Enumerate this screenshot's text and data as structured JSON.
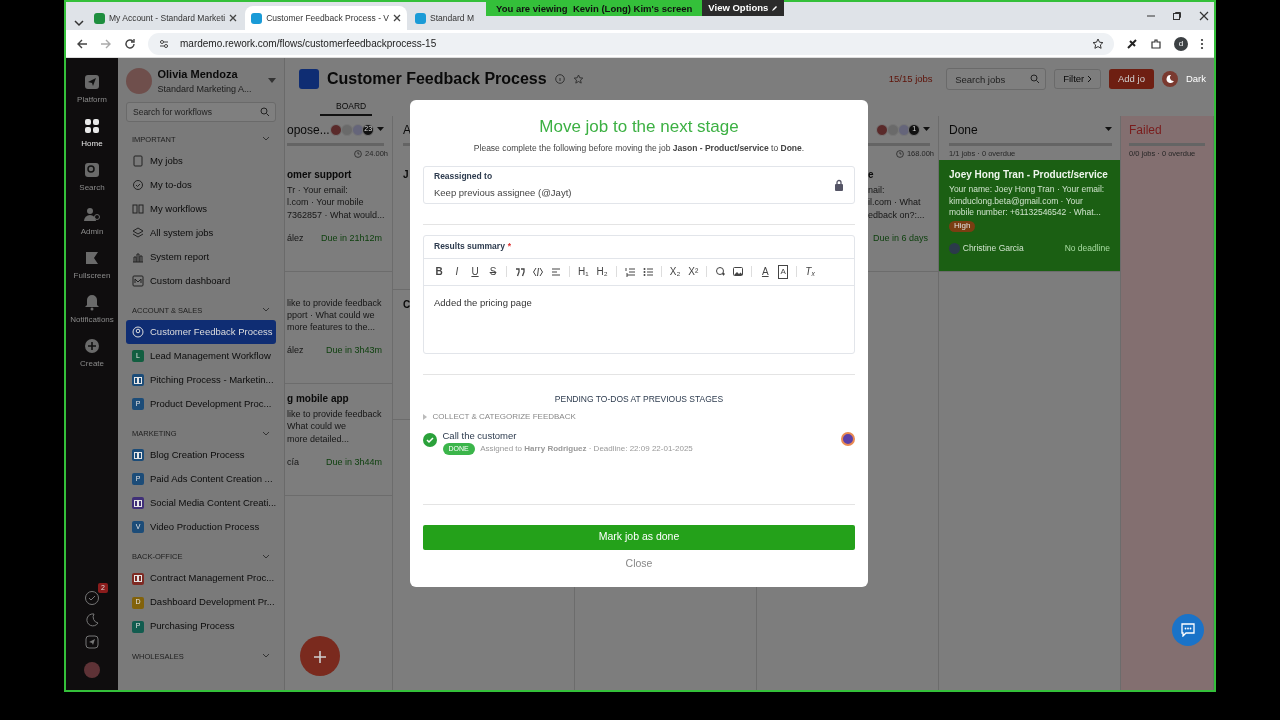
{
  "share_banner": {
    "text": "You are viewing  Kevin (Long) Kim's screen",
    "button": "View Options"
  },
  "browser": {
    "tabs": [
      {
        "title": "My Account - Standard Marketi",
        "selected": false,
        "color": "#1e8e3e"
      },
      {
        "title": "Customer Feedback Process - V",
        "selected": true,
        "color": "#1a9bd7"
      },
      {
        "title": "Standard M",
        "selected": false,
        "color": "#1a9bd7"
      }
    ],
    "url": "mardemo.rework.com/flows/customerfeedbackprocess-15",
    "profile": "d"
  },
  "rail": {
    "items": [
      {
        "label": "Platform",
        "selected": false
      },
      {
        "label": "Home",
        "selected": true
      },
      {
        "label": "Search",
        "selected": false
      },
      {
        "label": "Admin",
        "selected": false
      },
      {
        "label": "Fullscreen",
        "selected": false
      },
      {
        "label": "Notifications",
        "selected": false
      },
      {
        "label": "Create",
        "selected": false
      }
    ],
    "todo_badge": "2"
  },
  "user": {
    "name": "Olivia Mendoza",
    "org": "Standard Marketing A..."
  },
  "sidebar": {
    "search": {
      "placeholder": "Search for workflows"
    },
    "sections": [
      {
        "title": "IMPORTANT",
        "items": [
          {
            "kind": "nav",
            "label": "My jobs",
            "selected": false
          },
          {
            "kind": "nav",
            "label": "My to-dos",
            "selected": false
          },
          {
            "kind": "nav",
            "label": "My workflows",
            "selected": false
          },
          {
            "kind": "nav",
            "label": "All system jobs",
            "selected": false
          },
          {
            "kind": "nav",
            "label": "System report",
            "selected": false
          },
          {
            "kind": "nav",
            "label": "Custom dashboard",
            "selected": false
          }
        ]
      },
      {
        "title": "ACCOUNT & SALES",
        "items": [
          {
            "kind": "nav",
            "label": "Customer Feedback Process",
            "selected": true
          },
          {
            "kind": "workflow",
            "letter": "L",
            "label": "Lead Management Workflow",
            "color": "#125e40",
            "selected": false
          },
          {
            "kind": "workflow",
            "label": "Pitching Process - Marketin...",
            "color": "#1c4c78",
            "selected": false
          },
          {
            "kind": "workflow",
            "letter": "P",
            "label": "Product Development Proc...",
            "color": "#1c4c78",
            "selected": false
          }
        ]
      },
      {
        "title": "MARKETING",
        "items": [
          {
            "kind": "workflow",
            "label": "Blog Creation Process",
            "color": "#1c4c78",
            "selected": false
          },
          {
            "kind": "workflow",
            "letter": "P",
            "label": "Paid Ads Content Creation ...",
            "color": "#1c4c78",
            "selected": false
          },
          {
            "kind": "workflow",
            "label": "Social Media Content Creati...",
            "color": "#3f2f78",
            "selected": false
          },
          {
            "kind": "workflow",
            "letter": "V",
            "label": "Video Production Process",
            "color": "#1c4c78",
            "selected": false
          }
        ]
      },
      {
        "title": "BACK-OFFICE",
        "items": [
          {
            "kind": "workflow",
            "label": "Contract Management Proc...",
            "color": "#7e2a23",
            "selected": false
          },
          {
            "kind": "workflow",
            "letter": "D",
            "label": "Dashboard Development Pr...",
            "color": "#82620b",
            "selected": false
          },
          {
            "kind": "workflow",
            "letter": "P",
            "label": "Purchasing Process",
            "color": "#125c4f",
            "selected": false
          }
        ]
      },
      {
        "title": "WHOLESALES"
      }
    ]
  },
  "header": {
    "title": "Customer Feedback Process",
    "job_count": "15/15 jobs",
    "search": {
      "placeholder": "Search jobs"
    },
    "filter": "Filter",
    "add": "Add jo",
    "theme": "Dark",
    "tab": "BOARD"
  },
  "columns": [
    {
      "title": "opose...",
      "count": "23",
      "duration": "24.00h",
      "cards": [
        {
          "title": "omer support",
          "lines": [
            "Tr · Your email:",
            "l.com · Your mobile",
            "7362857 · What would..."
          ],
          "assignee": "ález",
          "due": "Due in 21h12m"
        },
        {
          "lines": [
            "like to provide feedback",
            "pport · What could we",
            "more features to the..."
          ],
          "assignee": "ález",
          "due": "Due in 3h43m"
        },
        {
          "title": "g mobile app",
          "lines": [
            "like to provide feedback",
            "What could we",
            "more detailed..."
          ],
          "assignee": "cía",
          "due": "Due in 3h44m"
        }
      ]
    },
    {
      "title": "A",
      "cards": [
        {
          "title": "J"
        },
        {
          "title": "C"
        }
      ]
    },
    {},
    {
      "count": "1",
      "duration": "168.00h",
      "cards": [
        {
          "title": "e",
          "lines": [
            "nail:",
            "il.com · What",
            "edback on?:..."
          ],
          "due": "Due in 6 days"
        }
      ]
    },
    {
      "title": "Done",
      "stats": "1/1 jobs · 0 overdue",
      "cards": [
        {
          "title": "Joey Hong Tran - Product/service",
          "lines": [
            "Your name: Joey Hong Tran · Your email: kimduclong.beta@gmail.com · Your mobile number: +61132546542 · What..."
          ],
          "tag": "High",
          "assignee": "Christine Garcia",
          "due": "No deadline",
          "color": "#1b5f13"
        }
      ]
    },
    {
      "title": "Failed",
      "stats": "0/0 jobs · 0 overdue",
      "color": "#7a1c1c"
    }
  ],
  "modal": {
    "title": "Move job to the next stage",
    "subtitle": "Please complete the following before moving the job **Jason - Product/service** to **Done**.",
    "reassigned": {
      "label": "Reassigned to",
      "value": "Keep previous assignee (@Jayt)"
    },
    "summary": {
      "label": "Results summary",
      "required_mark": "*",
      "text": "Added the pricing page",
      "toolbar": [
        {
          "kind": "text",
          "glyph": "B"
        },
        {
          "kind": "text",
          "glyph": "I"
        },
        {
          "kind": "text",
          "glyph": "U"
        },
        {
          "kind": "text",
          "glyph": "S"
        },
        {
          "kind": "sep"
        },
        {
          "kind": "quote"
        },
        {
          "kind": "code"
        },
        {
          "kind": "align"
        },
        {
          "kind": "sep"
        },
        {
          "kind": "text",
          "glyph": "H₁"
        },
        {
          "kind": "text",
          "glyph": "H₂"
        },
        {
          "kind": "sep"
        },
        {
          "kind": "ol"
        },
        {
          "kind": "ul"
        },
        {
          "kind": "sep"
        },
        {
          "kind": "text",
          "glyph": "X₂"
        },
        {
          "kind": "text",
          "glyph": "X²"
        },
        {
          "kind": "sep"
        },
        {
          "kind": "link"
        },
        {
          "kind": "image"
        },
        {
          "kind": "sep"
        },
        {
          "kind": "text",
          "glyph": "A"
        },
        {
          "kind": "boxed",
          "glyph": "A"
        },
        {
          "kind": "sep"
        },
        {
          "kind": "text",
          "glyph": "Tₓ"
        }
      ]
    },
    "pending": {
      "title": "PENDING TO-DOS AT PREVIOUS STAGES",
      "stages": [
        {
          "title": "COLLECT & CATEGORIZE FEEDBACK",
          "todos": [
            {
              "title": "Call the customer",
              "done": true,
              "status": "DONE",
              "meta": "Assigned to **Harry Rodriguez** · Deadline: 22:09 22-01-2025"
            }
          ]
        }
      ]
    },
    "primary": "Mark job as done",
    "close": "Close"
  }
}
